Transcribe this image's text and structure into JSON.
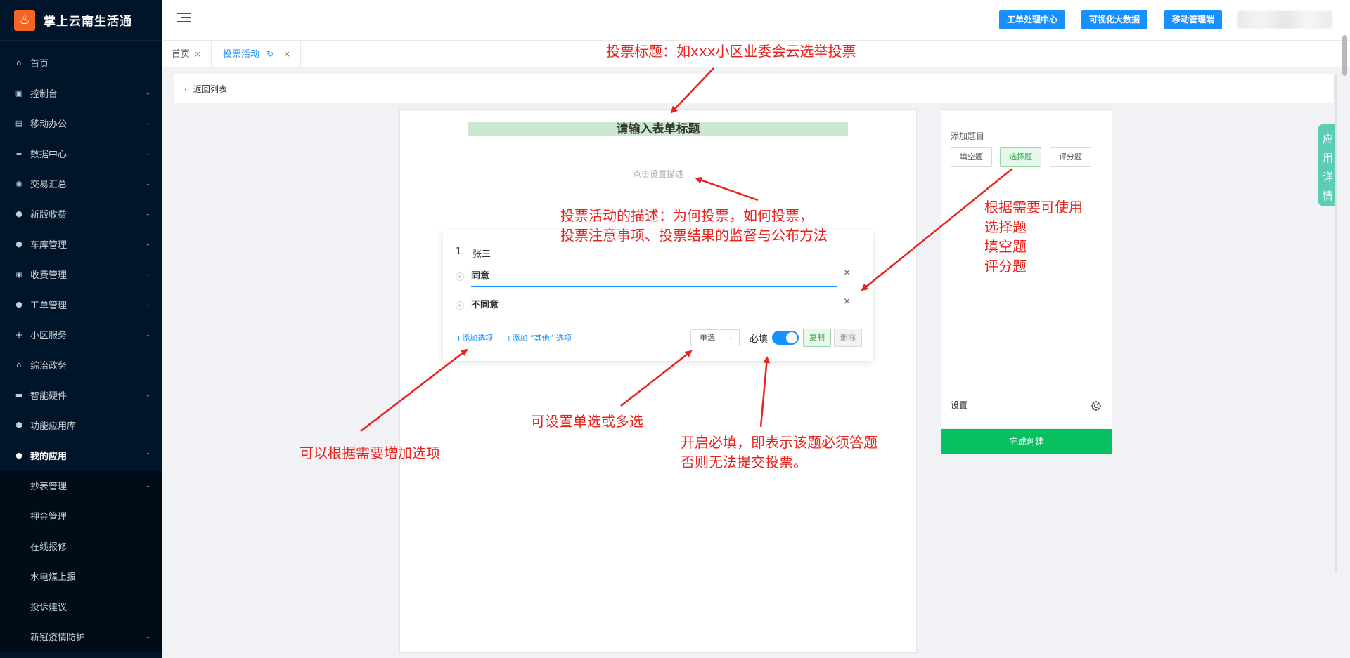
{
  "app": {
    "logo_char": "♨",
    "name": "掌上云南生活通"
  },
  "sidebar": {
    "items": [
      {
        "label": "首页",
        "icon": "home-icon",
        "glyph": "⌂",
        "chev": ""
      },
      {
        "label": "控制台",
        "icon": "dashboard-icon",
        "glyph": "▣",
        "chev": "⌄"
      },
      {
        "label": "移动办公",
        "icon": "briefcase-icon",
        "glyph": "▤",
        "chev": "⌄"
      },
      {
        "label": "数据中心",
        "icon": "database-icon",
        "glyph": "≡",
        "chev": "⌄"
      },
      {
        "label": "交易汇总",
        "icon": "money-bag-icon",
        "glyph": "◉",
        "chev": "⌄"
      },
      {
        "label": "新版收费",
        "icon": "chat-icon",
        "glyph": "●",
        "chev": "⌄"
      },
      {
        "label": "车库管理",
        "icon": "chat-icon",
        "glyph": "●",
        "chev": "⌄"
      },
      {
        "label": "收费管理",
        "icon": "money-bag-icon",
        "glyph": "◉",
        "chev": "⌄"
      },
      {
        "label": "工单管理",
        "icon": "chat-icon",
        "glyph": "●",
        "chev": "⌄"
      },
      {
        "label": "小区服务",
        "icon": "shield-icon",
        "glyph": "◈",
        "chev": "⌄"
      },
      {
        "label": "综治政务",
        "icon": "bank-icon",
        "glyph": "⌂",
        "chev": ""
      },
      {
        "label": "智能硬件",
        "icon": "hardware-icon",
        "glyph": "▬",
        "chev": "⌄"
      },
      {
        "label": "功能应用库",
        "icon": "hexagon-icon",
        "glyph": "⬢",
        "chev": ""
      },
      {
        "label": "我的应用",
        "icon": "user-icon",
        "glyph": "●",
        "chev": "⌃"
      }
    ],
    "subitems": [
      {
        "label": "抄表管理",
        "chev": "⌄"
      },
      {
        "label": "押金管理",
        "chev": ""
      },
      {
        "label": "在线报修",
        "chev": ""
      },
      {
        "label": "水电煤上报",
        "chev": ""
      },
      {
        "label": "投诉建议",
        "chev": ""
      },
      {
        "label": "新冠疫情防护",
        "chev": "⌄"
      }
    ]
  },
  "header": {
    "buttons": [
      "工单处理中心",
      "可视化大数据",
      "移动管理端"
    ]
  },
  "tabs": [
    {
      "label": "首页",
      "close": "×"
    },
    {
      "label": "投票活动",
      "refresh": "↻",
      "close": "×"
    }
  ],
  "back": {
    "label": "返回列表",
    "arrow": "‹"
  },
  "form": {
    "title": "请输入表单标题",
    "desc_placeholder": "点击设置描述",
    "question": {
      "number": "1.",
      "title": "张三",
      "options": [
        "同意",
        "不同意"
      ],
      "remove": "×",
      "add_option": "+添加选项",
      "add_other": "+添加 “其他” 选项",
      "type_value": "单选",
      "caret": "⌄",
      "required_label": "必填",
      "required": true,
      "copy": "复制",
      "delete": "删除"
    }
  },
  "right_panel": {
    "title": "添加题目",
    "types": [
      "填空题",
      "选择题",
      "评分题"
    ],
    "active_type": "选择题",
    "settings": "设置",
    "finish": "完成创建"
  },
  "side_tab": [
    "应",
    "用",
    "详",
    "情"
  ],
  "annotations": {
    "title_note": "投票标题：如xxx小区业委会云选举投票",
    "desc_note_1": "投票活动的描述：为何投票，如何投票，",
    "desc_note_2": "投票注意事项、投票结果的监督与公布方法",
    "type_note_1": "根据需要可使用",
    "type_note_2": "选择题",
    "type_note_3": "填空题",
    "type_note_4": "评分题",
    "option_note": "可以根据需要增加选项",
    "single_note": "可设置单选或多选",
    "req_note_1": "开启必填，即表示该题必须答题",
    "req_note_2": "否则无法提交投票。"
  },
  "colors": {
    "sidebar_bg": "#001529",
    "primary": "#1890ff",
    "green": "#07c160",
    "annotation": "#e8231d"
  }
}
